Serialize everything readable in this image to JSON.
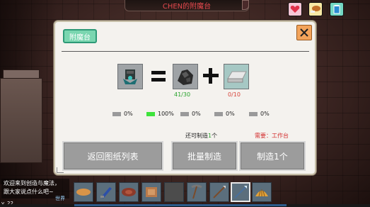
{
  "title": "CHEN的附魔台",
  "panel": {
    "tab_label": "附魔台",
    "close_label": "X",
    "result_item": "enchanted-armor-icon",
    "ingredients": [
      {
        "icon": "coal-ore-icon",
        "count_text": "41/30",
        "status_color": "#27a32b"
      },
      {
        "icon": "iron-ingot-icon",
        "count_text": "0/10",
        "status_color": "#d8433a"
      }
    ],
    "probabilities": [
      {
        "value": "0%",
        "active": false
      },
      {
        "value": "100%",
        "active": true
      },
      {
        "value": "0%",
        "active": false
      },
      {
        "value": "0%",
        "active": false
      },
      {
        "value": "0%",
        "active": false
      }
    ],
    "can_craft_prefix": "还可制造",
    "can_craft_count": "1",
    "can_craft_suffix": "个",
    "requirement": "需要：工作台",
    "buttons": {
      "back": "返回图纸列表",
      "batch": "批量制造",
      "make_one": "制造1个"
    }
  },
  "hud_icons": [
    "heart-icon",
    "food-icon",
    "water-icon"
  ],
  "chat": {
    "line1": "欢迎来到创造与魔法，",
    "line2": "跟大家说点什么吧~",
    "tag": "世界"
  },
  "version": "v. 22",
  "hotbar": [
    "bread-icon",
    "blue-sword-icon",
    "meat-icon",
    "leather-icon",
    "empty-slot",
    "pickaxe-icon",
    "spear-icon",
    "blue-spear-icon",
    "shell-icon"
  ]
}
